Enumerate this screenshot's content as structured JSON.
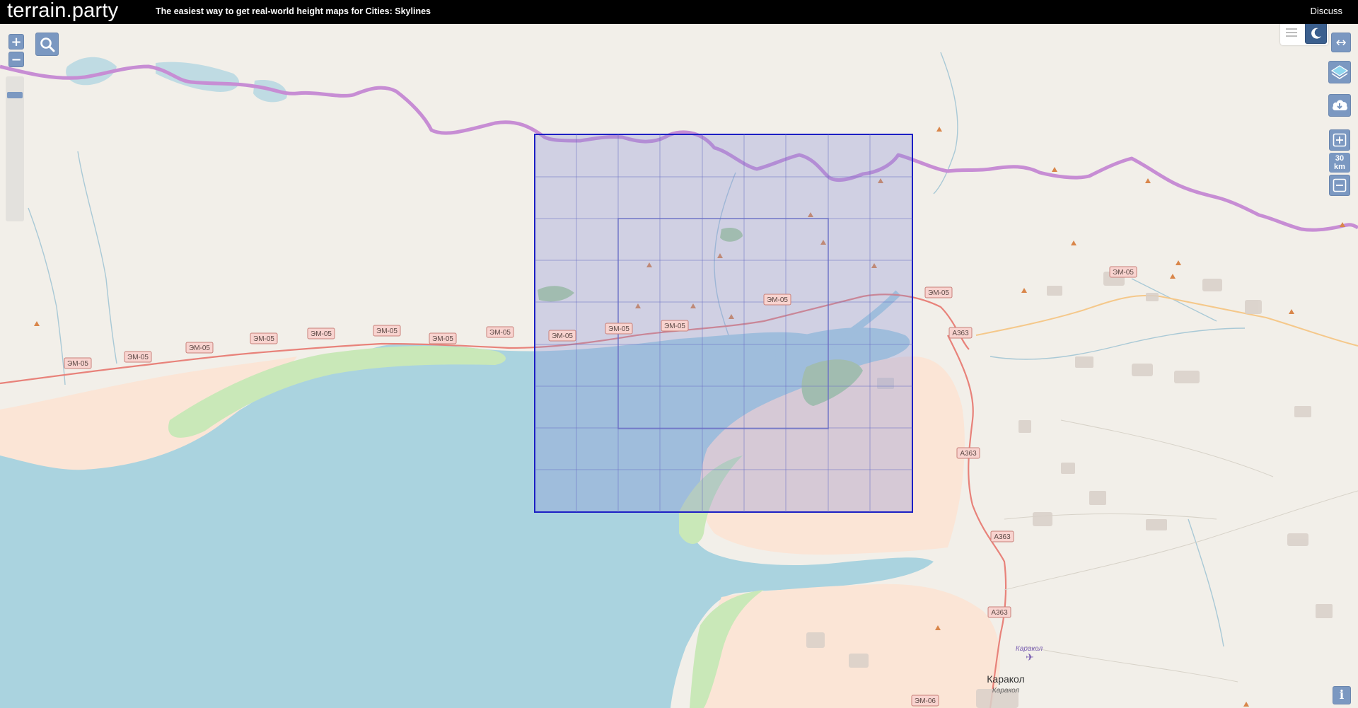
{
  "header": {
    "brand": "terrain.party",
    "tagline": "The easiest way to get real-world height maps for Cities: Skylines",
    "discuss_label": "Discuss"
  },
  "controls": {
    "zoom_in": "+",
    "zoom_out": "−",
    "scale_value": "30",
    "scale_unit": "km",
    "info": "i",
    "swap": "↔"
  },
  "map": {
    "roads": [
      {
        "label": "ЭМ-05"
      },
      {
        "label": "ЭМ-05"
      },
      {
        "label": "ЭМ-05"
      },
      {
        "label": "ЭМ-05"
      },
      {
        "label": "ЭМ-05"
      },
      {
        "label": "ЭМ-05"
      },
      {
        "label": "ЭМ-05"
      },
      {
        "label": "ЭМ-05"
      },
      {
        "label": "ЭМ-05"
      },
      {
        "label": "ЭМ-05"
      },
      {
        "label": "ЭМ-05"
      },
      {
        "label": "ЭМ-05"
      },
      {
        "label": "ЭМ-05"
      },
      {
        "label": "ЭМ-05"
      },
      {
        "label": "A363"
      },
      {
        "label": "A363"
      },
      {
        "label": "A363"
      },
      {
        "label": "A363"
      },
      {
        "label": "ЭМ-06"
      }
    ],
    "cities": [
      {
        "name": "Каракол",
        "subname": "Каракол"
      }
    ],
    "airport": {
      "name": "Каракол"
    },
    "colors": {
      "land": "#f2efe9",
      "water": "#aad3df",
      "residential": "#fbe5d6",
      "grass": "#c9e8b8",
      "border": "#c78dd4",
      "primary_road": "#e8827a",
      "secondary_road": "#f5c88a",
      "selection_fill": "#8a8fd8",
      "selection_stroke": "#1c1fc4"
    }
  }
}
